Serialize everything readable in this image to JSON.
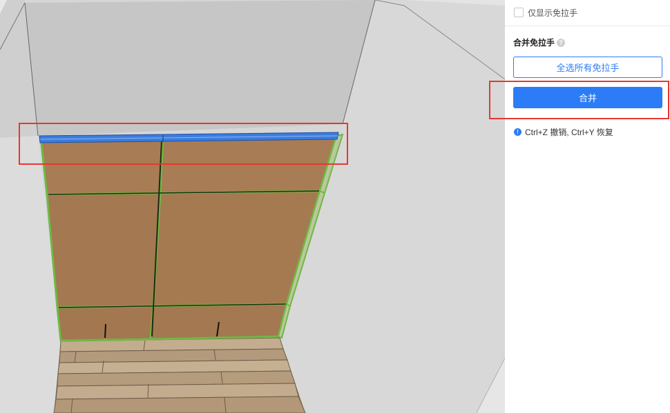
{
  "panel": {
    "show_only_checkbox_label": "仅显示免拉手",
    "section_title": "合并免拉手",
    "select_all_button": "全选所有免拉手",
    "merge_button": "合并",
    "shortcut_hint": "Ctrl+Z 撤销, Ctrl+Y 恢复"
  },
  "icons": {
    "help": "question-mark-icon",
    "info": "info-icon"
  },
  "colors": {
    "accent": "#2b7cf6",
    "highlight_box": "#e8372c",
    "panel_outline": "#7dc05a",
    "selected_handle": "#3a7de0",
    "wood": "#a87c54"
  }
}
